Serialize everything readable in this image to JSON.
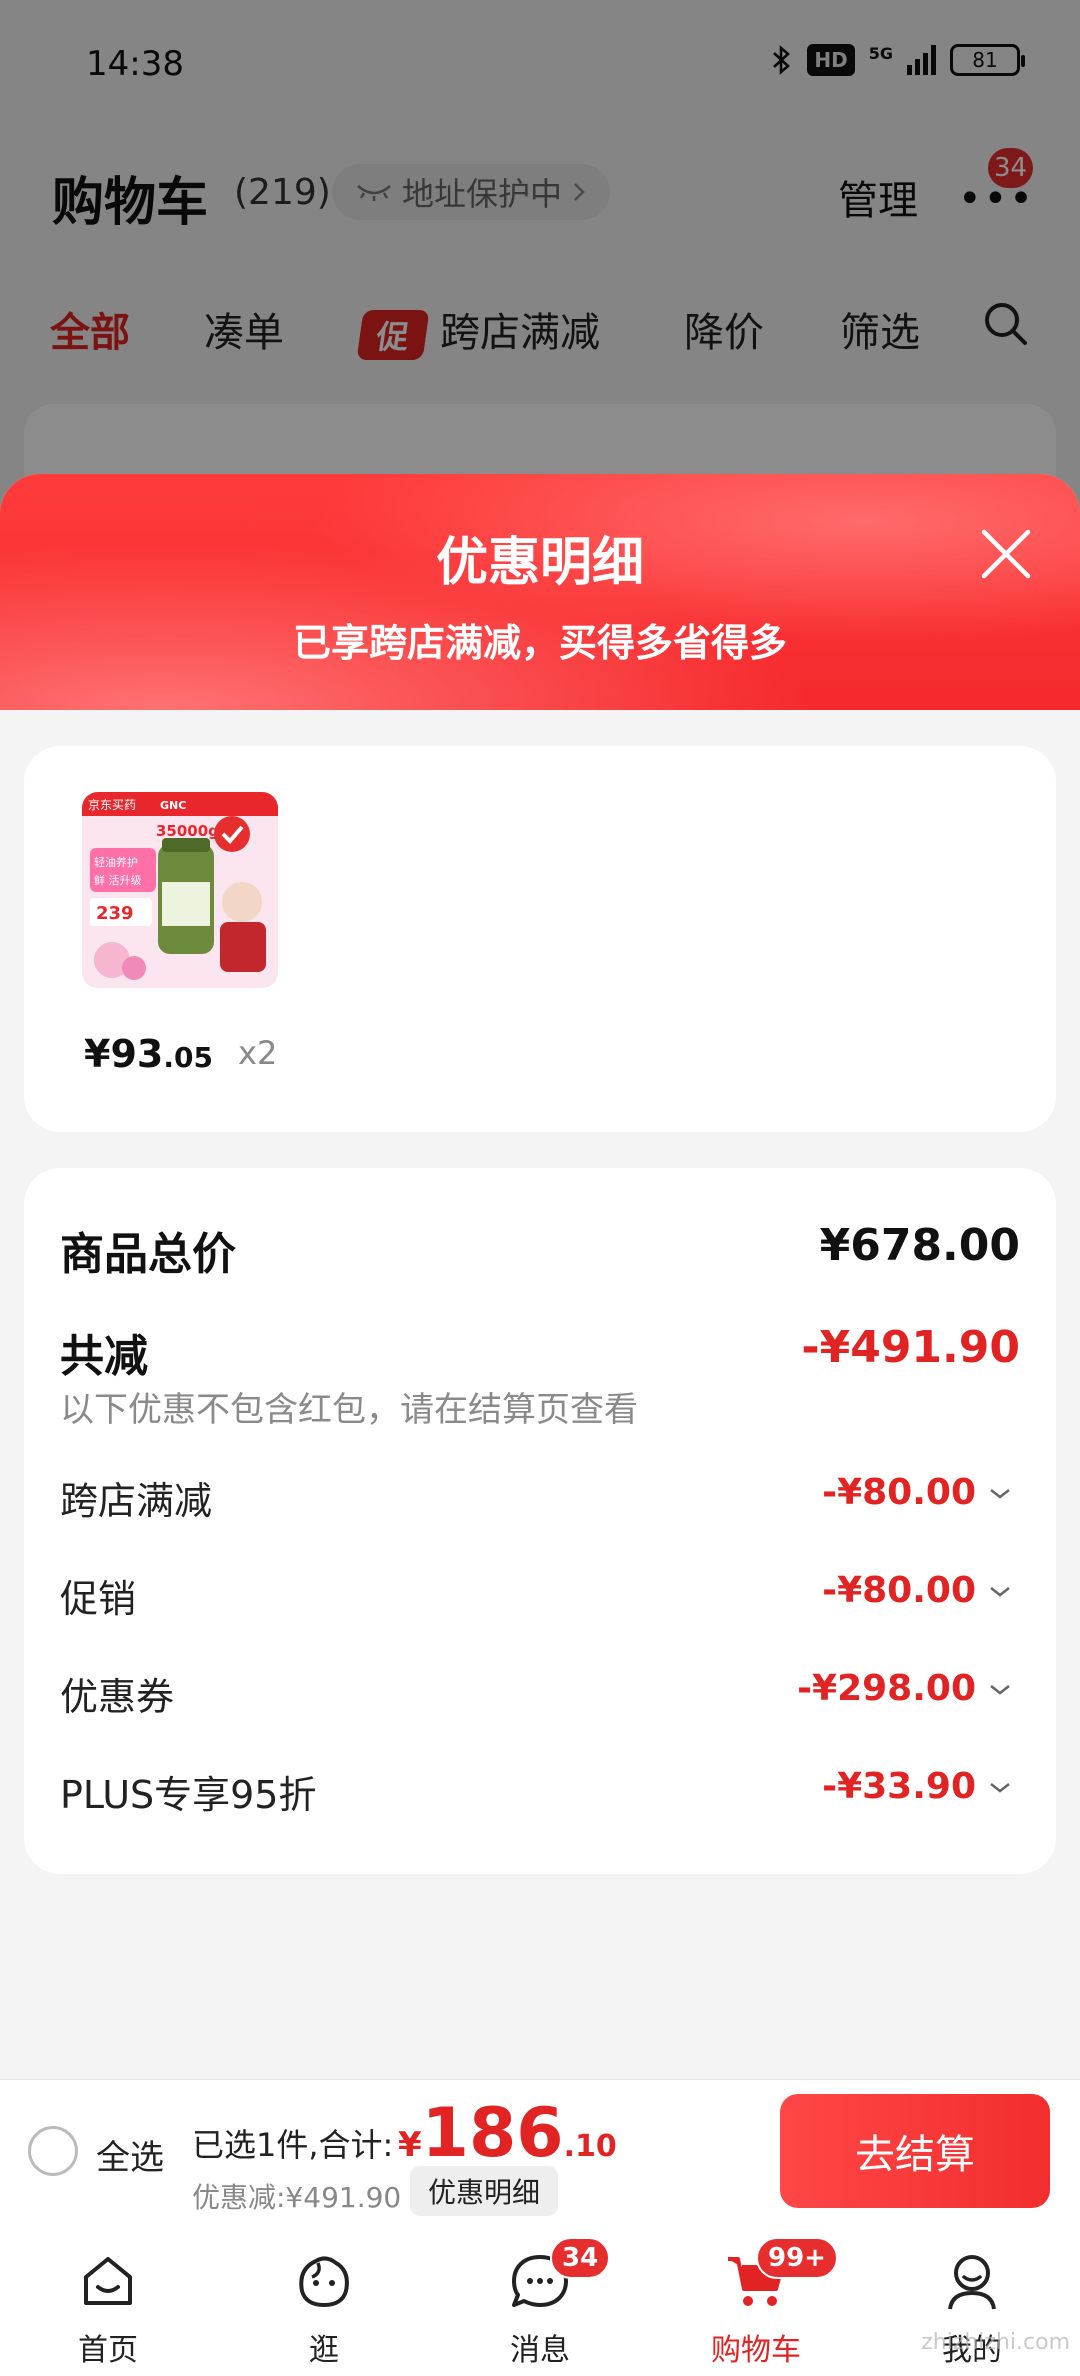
{
  "status_bar": {
    "time": "14:38",
    "network": "5G",
    "hd": "HD",
    "battery": "81"
  },
  "header": {
    "title": "购物车",
    "count": "(219)",
    "address_pill": "地址保护中",
    "manage_label": "管理",
    "more_badge": "34"
  },
  "filter_tabs": [
    {
      "label": "全部",
      "active": true
    },
    {
      "label": "凑单"
    },
    {
      "label": "跨店满减",
      "tag": "促"
    },
    {
      "label": "降价"
    },
    {
      "label": "筛选"
    }
  ],
  "sheet": {
    "title": "优惠明细",
    "subtitle": "已享跨店满减，买得多省得多",
    "product": {
      "price_symbol": "¥",
      "price_int": "93",
      "price_dec": ".05",
      "qty": "x2",
      "thumb_text": {
        "store": "京东买药",
        "brand": "GNC",
        "weight": "35000g",
        "promo": "轻油养护",
        "upgrade": "鲜 活升级",
        "price": "239"
      }
    },
    "summary": {
      "total_label": "商品总价",
      "total_value": "¥678.00",
      "reduce_label": "共减",
      "reduce_value": "-¥491.90",
      "note": "以下优惠不包含红包，请在结算页查看",
      "details": [
        {
          "label": "跨店满减",
          "value": "-¥80.00"
        },
        {
          "label": "促销",
          "value": "-¥80.00"
        },
        {
          "label": "优惠券",
          "value": "-¥298.00"
        },
        {
          "label": "PLUS专享95折",
          "value": "-¥33.90"
        }
      ]
    }
  },
  "checkout": {
    "select_all_label": "全选",
    "selected_text": "已选1件,合计:",
    "amount_symbol": "¥",
    "amount_int": "186",
    "amount_dec": ".10",
    "discount_text": "优惠减:¥491.90",
    "detail_chip": "优惠明细",
    "checkout_button": "去结算"
  },
  "bottom_nav": [
    {
      "label": "首页",
      "icon": "home-icon"
    },
    {
      "label": "逛",
      "icon": "stroll-icon"
    },
    {
      "label": "消息",
      "icon": "message-icon",
      "badge": "34"
    },
    {
      "label": "购物车",
      "icon": "cart-icon",
      "badge": "99+",
      "active": true
    },
    {
      "label": "我的",
      "icon": "profile-icon"
    }
  ],
  "watermark": "zhizhizhi.com",
  "colors": {
    "accent": "#e12323",
    "header_red": "#f5292d"
  }
}
